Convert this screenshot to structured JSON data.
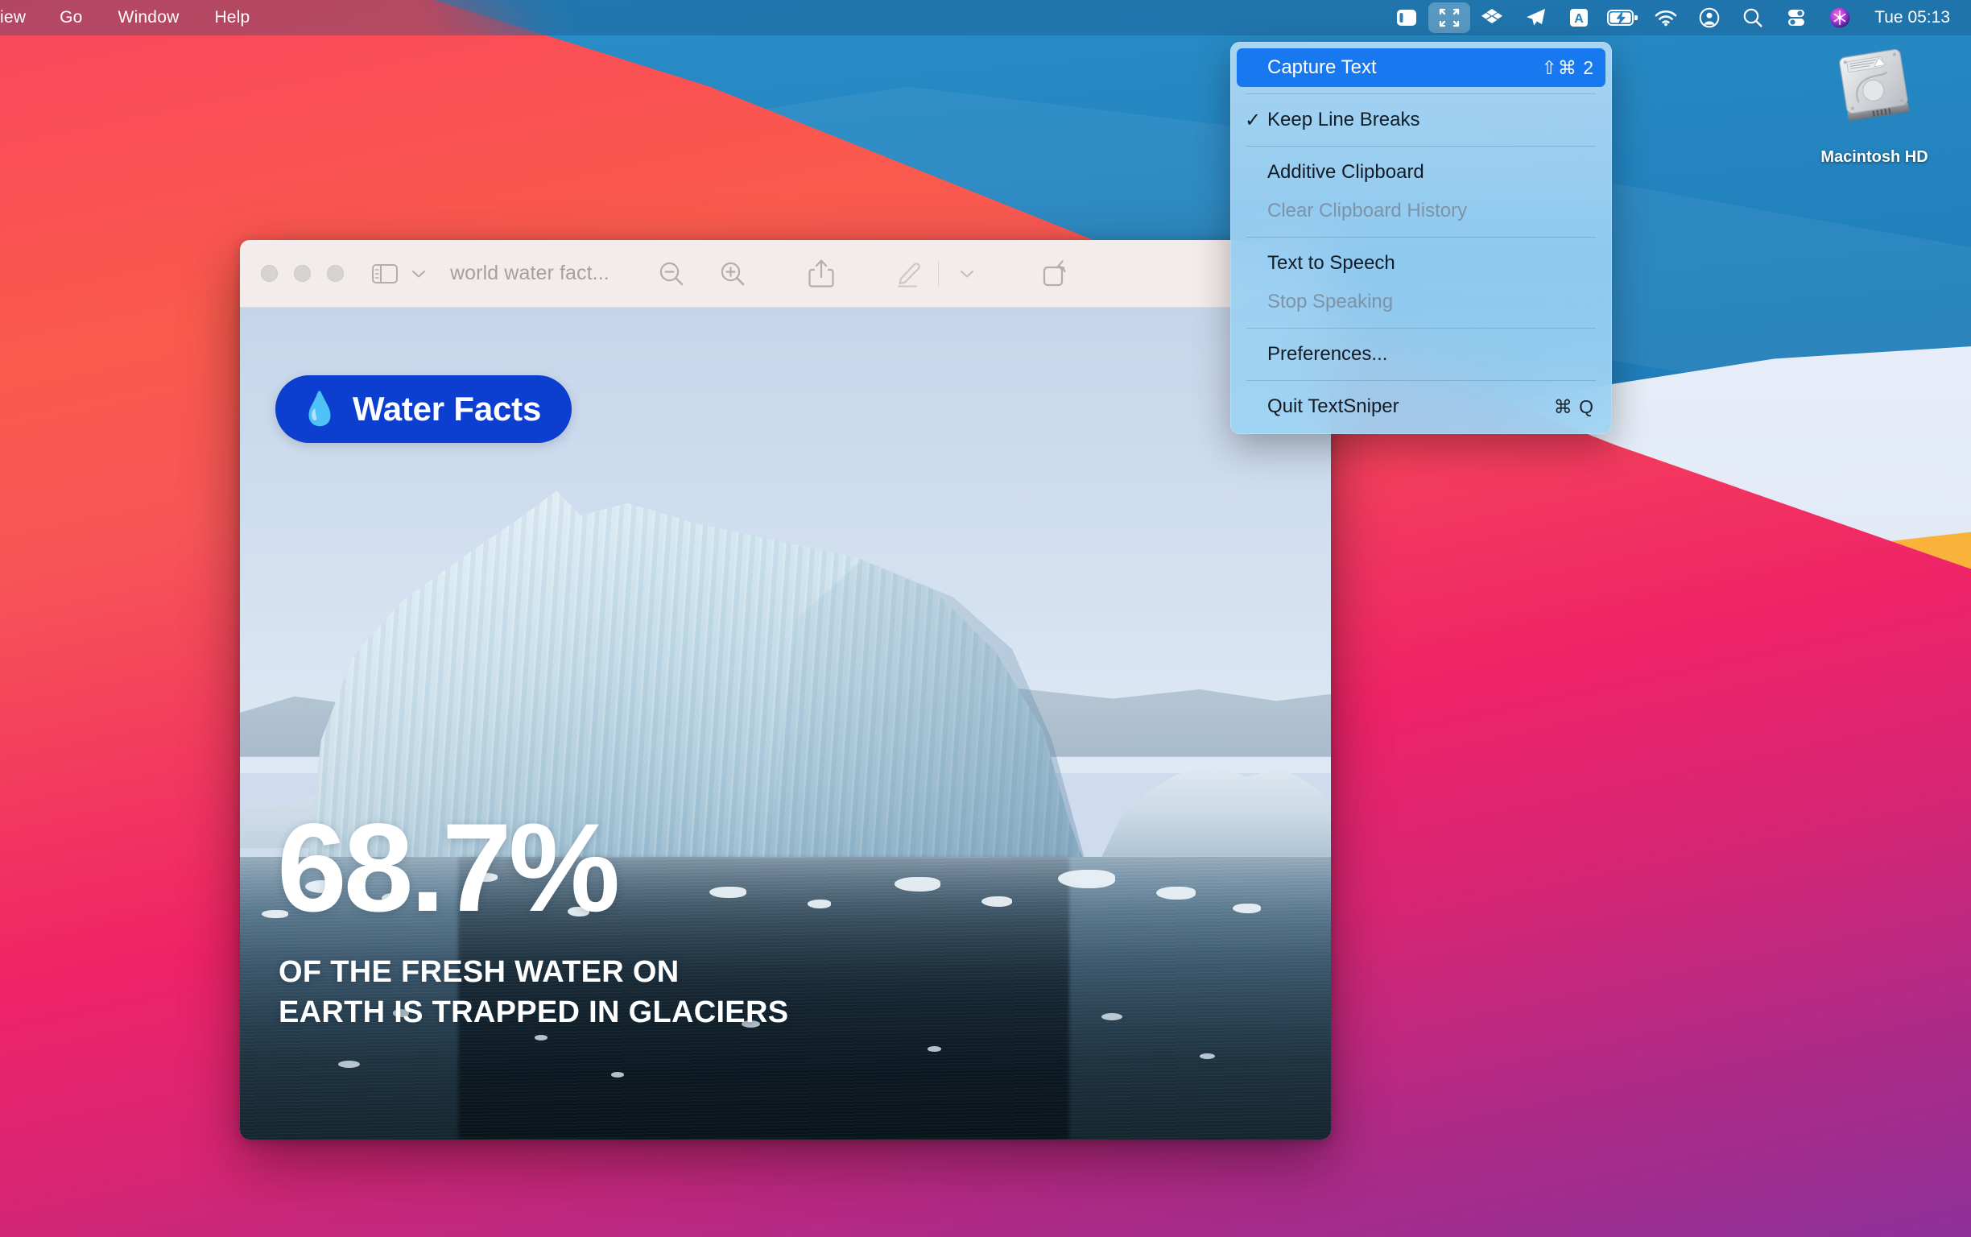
{
  "menubar": {
    "left_items": [
      {
        "label": "iew",
        "name": "menu-view",
        "truncated": true
      },
      {
        "label": "Go",
        "name": "menu-go"
      },
      {
        "label": "Window",
        "name": "menu-window"
      },
      {
        "label": "Help",
        "name": "menu-help"
      }
    ],
    "status_icons": [
      {
        "name": "stack-panel-icon",
        "label": "Panel"
      },
      {
        "name": "textsniper-icon",
        "label": "TextSniper",
        "selected": true
      },
      {
        "name": "dropbox-icon",
        "label": "Dropbox"
      },
      {
        "name": "telegram-icon",
        "label": "Telegram"
      },
      {
        "name": "input-source-icon",
        "label": "A"
      },
      {
        "name": "battery-charging-icon",
        "label": "Battery"
      },
      {
        "name": "wifi-icon",
        "label": "Wi-Fi"
      },
      {
        "name": "user-account-icon",
        "label": "Account"
      },
      {
        "name": "spotlight-search-icon",
        "label": "Spotlight"
      },
      {
        "name": "control-center-icon",
        "label": "Control Center"
      },
      {
        "name": "siri-icon",
        "label": "Siri"
      }
    ],
    "clock": "Tue 05:13",
    "accent_selected_bg": "#ffffff42"
  },
  "desktop": {
    "icons": [
      {
        "label": "Macintosh HD",
        "name": "macintosh-hd-icon"
      }
    ],
    "wallpaper": {
      "name": "big-sur-wallpaper",
      "colors": [
        "#2a8fc9",
        "#1a6faa",
        "#f8475f",
        "#f33a5e",
        "#8e3098",
        "#f7a833",
        "#eef3fb",
        "#f2693f"
      ]
    }
  },
  "window": {
    "app": "Preview",
    "title": "world water fact...",
    "active": false,
    "traffic_lights": [
      {
        "name": "close-button",
        "label": "Close"
      },
      {
        "name": "minimize-button",
        "label": "Minimize"
      },
      {
        "name": "zoom-button",
        "label": "Zoom"
      }
    ],
    "toolbar": [
      {
        "name": "sidebar-toggle-button",
        "label": "Sidebar"
      },
      {
        "name": "sidebar-chevron-down-icon",
        "label": "Sidebar options"
      },
      {
        "name": "zoom-out-button",
        "label": "Zoom Out"
      },
      {
        "name": "zoom-in-button",
        "label": "Zoom In"
      },
      {
        "name": "share-button",
        "label": "Share"
      },
      {
        "name": "markup-button",
        "label": "Markup"
      },
      {
        "name": "markup-chevron-down-icon",
        "label": "Markup options"
      },
      {
        "name": "rotate-button",
        "label": "Rotate"
      }
    ]
  },
  "document": {
    "badge": {
      "emoji": "💧",
      "text": "Water Facts",
      "bg": "#0c3fd0"
    },
    "stat": "68.7%",
    "caption_line1": "OF THE FRESH WATER ON",
    "caption_line2": "EARTH IS TRAPPED IN GLACIERS",
    "image_subject": "iceberg-photo"
  },
  "textsniper_menu": {
    "groups": [
      [
        {
          "label": "Capture Text",
          "shortcut": "⇧⌘ 2",
          "selected": true,
          "enabled": true,
          "checked": false,
          "name": "menu-item-capture-text"
        }
      ],
      [
        {
          "label": "Keep Line Breaks",
          "shortcut": "",
          "selected": false,
          "enabled": true,
          "checked": true,
          "name": "menu-item-keep-line-breaks"
        }
      ],
      [
        {
          "label": "Additive Clipboard",
          "shortcut": "",
          "selected": false,
          "enabled": true,
          "checked": false,
          "name": "menu-item-additive-clipboard"
        },
        {
          "label": "Clear Clipboard History",
          "shortcut": "",
          "selected": false,
          "enabled": false,
          "checked": false,
          "name": "menu-item-clear-clipboard-history"
        }
      ],
      [
        {
          "label": "Text to Speech",
          "shortcut": "",
          "selected": false,
          "enabled": true,
          "checked": false,
          "name": "menu-item-text-to-speech"
        },
        {
          "label": "Stop Speaking",
          "shortcut": "",
          "selected": false,
          "enabled": false,
          "checked": false,
          "name": "menu-item-stop-speaking"
        }
      ],
      [
        {
          "label": "Preferences...",
          "shortcut": "",
          "selected": false,
          "enabled": true,
          "checked": false,
          "name": "menu-item-preferences"
        }
      ],
      [
        {
          "label": "Quit TextSniper",
          "shortcut": "⌘ Q",
          "selected": false,
          "enabled": true,
          "checked": false,
          "name": "menu-item-quit-textsniper"
        }
      ]
    ],
    "highlight_color": "#1878f0",
    "check_glyph": "✓"
  }
}
